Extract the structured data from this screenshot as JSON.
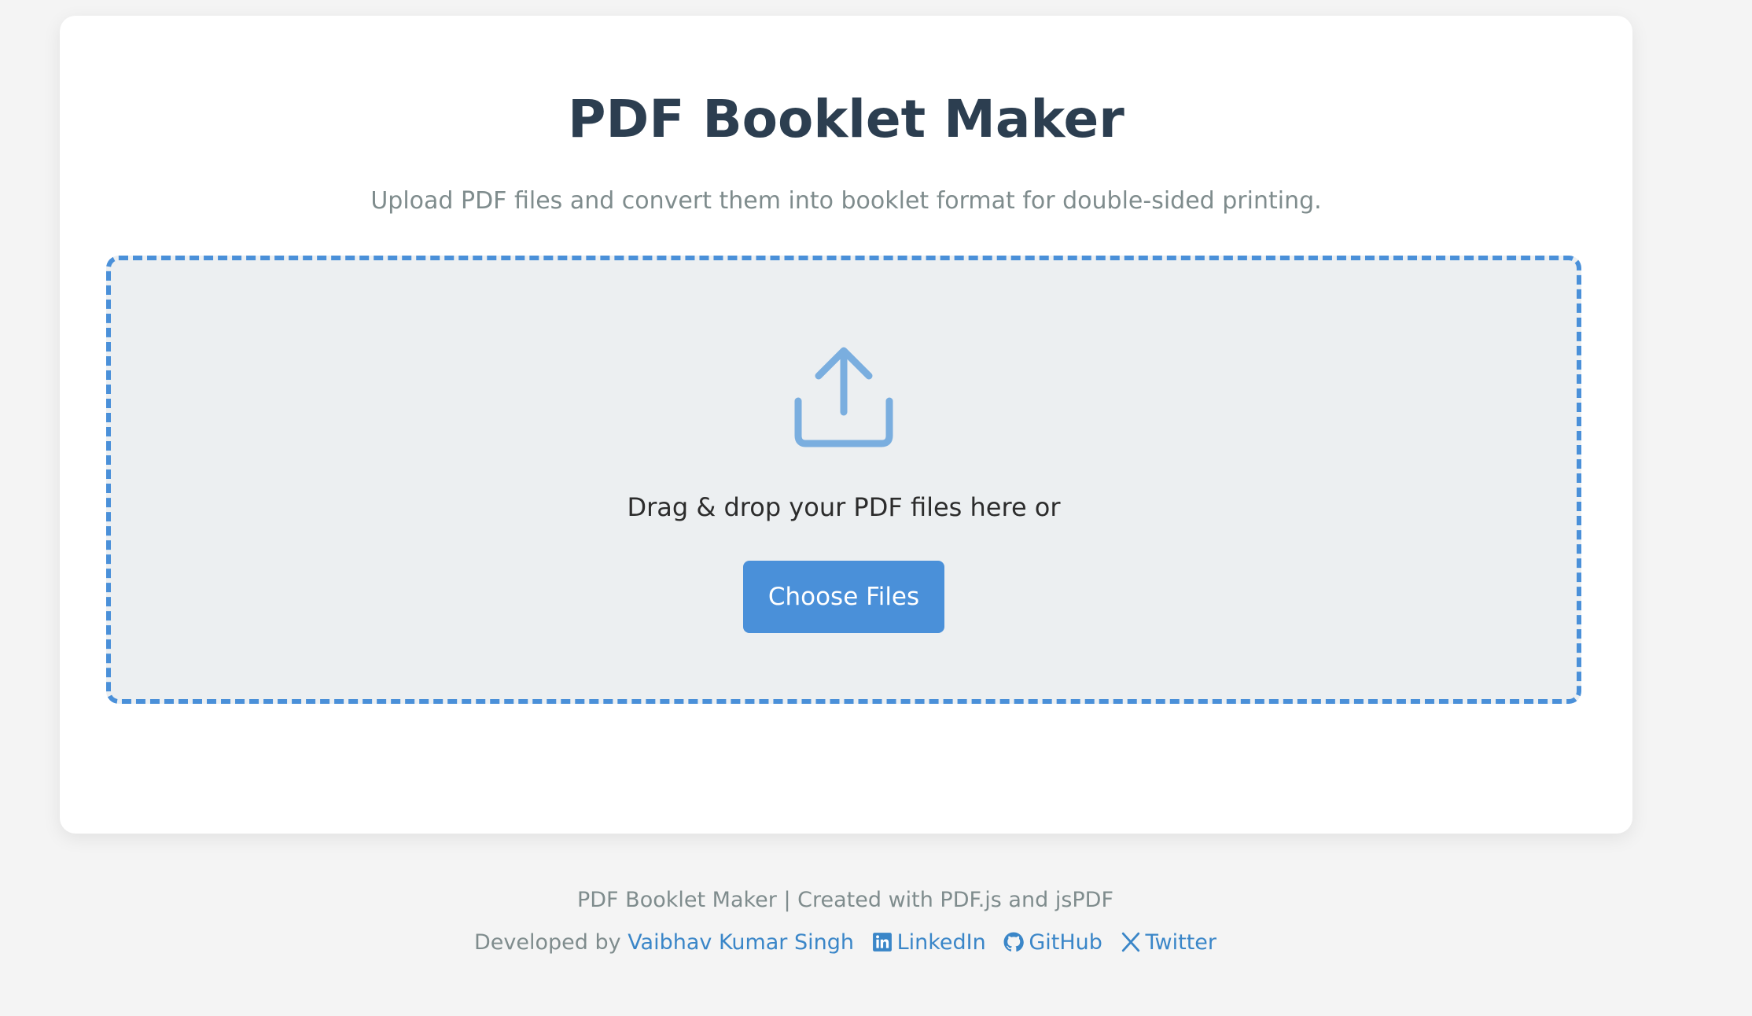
{
  "header": {
    "title": "PDF Booklet Maker",
    "subtitle": "Upload PDF files and convert them into booklet format for double-sided printing."
  },
  "dropzone": {
    "icon": "upload-icon",
    "text": "Drag & drop your PDF files here or",
    "button_label": "Choose Files"
  },
  "footer": {
    "line1": "PDF Booklet Maker | Created with PDF.js and jsPDF",
    "developed_by": "Developed by",
    "author": "Vaibhav Kumar Singh",
    "links": {
      "linkedin": "LinkedIn",
      "github": "GitHub",
      "twitter": "Twitter"
    }
  },
  "colors": {
    "accent": "#4a90d9",
    "title": "#2c3e50",
    "muted": "#7f8c8d",
    "link": "#3a86c8",
    "dropzone_bg": "#eceff1",
    "page_bg": "#f4f4f4"
  }
}
